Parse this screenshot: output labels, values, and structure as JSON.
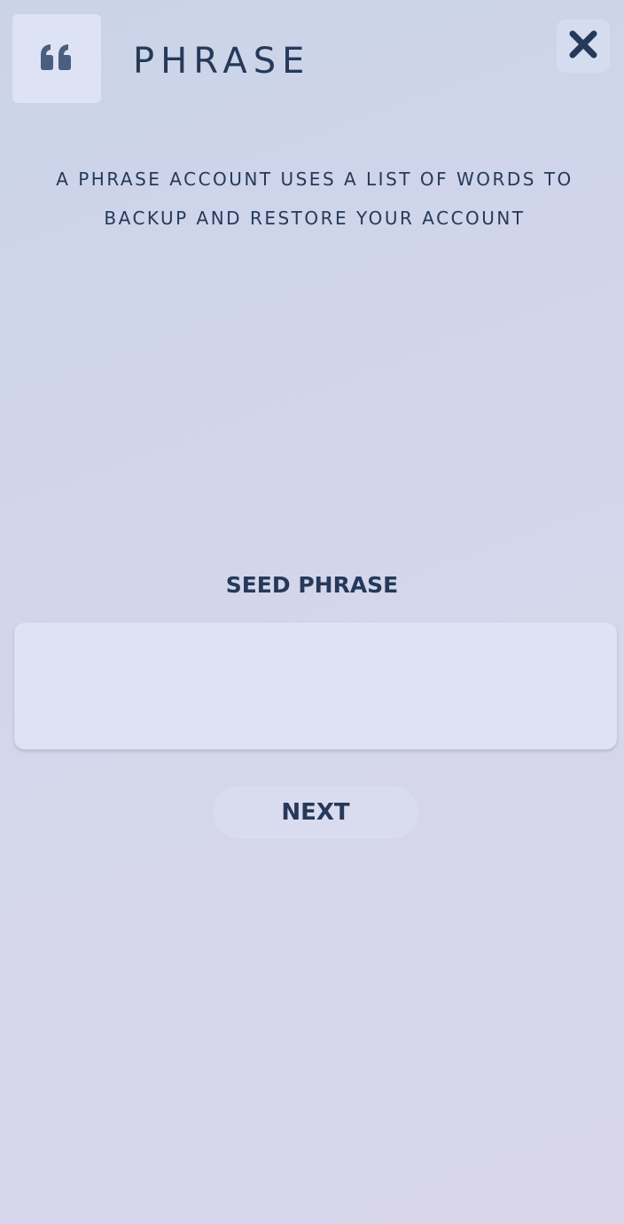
{
  "header": {
    "icon": "quote-icon",
    "title": "PHRASE",
    "close_icon": "close-icon"
  },
  "description": "A PHRASE ACCOUNT USES A LIST OF WORDS TO BACKUP AND RESTORE YOUR ACCOUNT",
  "seed": {
    "label": "SEED PHRASE",
    "value": "",
    "placeholder": ""
  },
  "next_button": {
    "label": "NEXT"
  },
  "colors": {
    "text": "#25395a",
    "icon": "#4a5f80",
    "input_bg": "#dfe1f4"
  }
}
